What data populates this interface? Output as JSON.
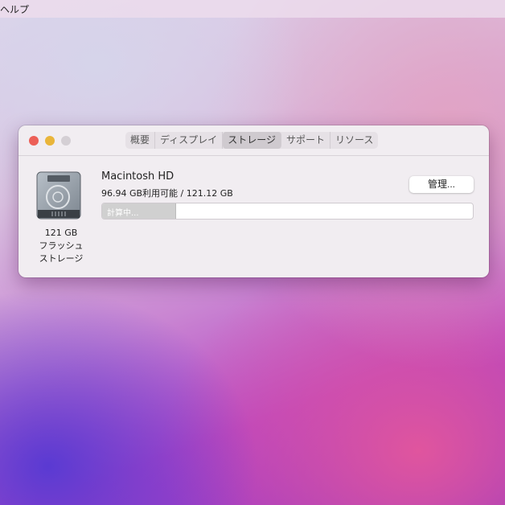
{
  "menubar": {
    "items": [
      "ヘルプ"
    ]
  },
  "window": {
    "tabs": [
      "概要",
      "ディスプレイ",
      "ストレージ",
      "サポート",
      "リソース"
    ],
    "active_tab": "ストレージ",
    "disk": {
      "capacity": "121 GB",
      "type_line1": "フラッシュ",
      "type_line2": "ストレージ",
      "name": "Macintosh HD",
      "availability": "96.94 GB利用可能 / 121.12 GB",
      "bar_label": "計算中...",
      "bar_fill_fraction": 0.2
    },
    "manage_label": "管理..."
  },
  "colors": {
    "close": "#ec5f57",
    "minimize": "#e9b53a",
    "zoom": "#cfcacf"
  }
}
